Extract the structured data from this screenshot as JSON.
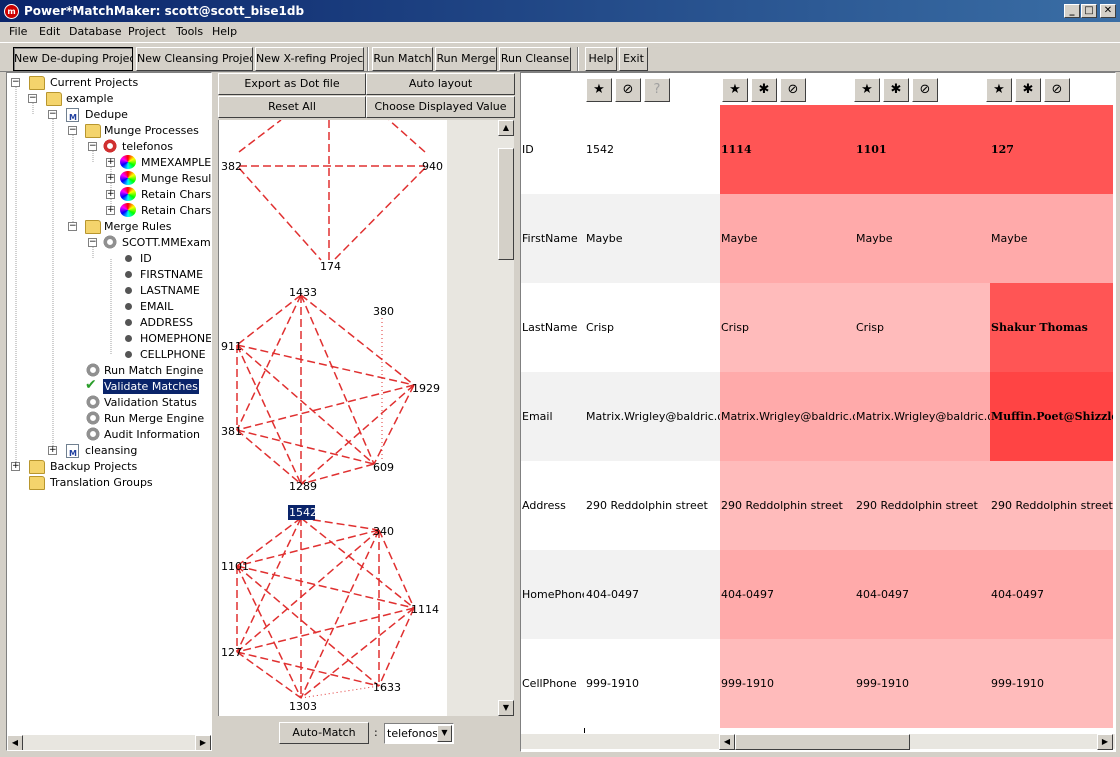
{
  "window": {
    "title": "Power*MatchMaker: scott@scott_bise1db",
    "min": "_",
    "max": "□",
    "close": "✕",
    "app_icon": "pm-logo-icon"
  },
  "menu": [
    "File",
    "Edit",
    "Database",
    "Project",
    "Tools",
    "Help"
  ],
  "toolbar": {
    "new_dedupe": "New De-duping Project",
    "new_cleansing": "New Cleansing Project",
    "new_xref": "New X-refing Project",
    "run_match": "Run Match",
    "run_merge": "Run Merge",
    "run_cleanse": "Run Cleanse",
    "help": "Help",
    "exit": "Exit"
  },
  "tree": {
    "current_projects": "Current Projects",
    "example": "example",
    "dedupe": "Dedupe",
    "munge_processes": "Munge Processes",
    "telefonos": "telefonos",
    "mmexample": "MMEXAMPLETA",
    "munge_results": "Munge Results",
    "retain_chars_1": "Retain Chars",
    "retain_chars_2": "Retain Chars",
    "merge_rules": "Merge Rules",
    "scott_mmexample": "SCOTT.MMExample",
    "columns": [
      "ID",
      "FIRSTNAME",
      "LASTNAME",
      "EMAIL",
      "ADDRESS",
      "HOMEPHONE",
      "CELLPHONE"
    ],
    "run_match_engine": "Run Match Engine",
    "validate_matches": "Validate Matches",
    "validation_status": "Validation Status",
    "run_merge_engine": "Run Merge Engine",
    "audit_information": "Audit Information",
    "cleansing": "cleansing",
    "backup_projects": "Backup Projects",
    "translation_groups": "Translation Groups"
  },
  "graph_panel": {
    "export_dot": "Export as Dot file",
    "auto_layout": "Auto layout",
    "reset_all": "Reset All",
    "choose_displayed": "Choose Displayed Value",
    "auto_match": "Auto-Match",
    "colon": ":",
    "munge_select": "telefonos",
    "selected_node": "1542"
  },
  "graph_nodes": {
    "g1": [
      "382",
      "940",
      "174"
    ],
    "g2": [
      "1433",
      "380",
      "911",
      "1929",
      "381",
      "609",
      "1289"
    ],
    "g3": [
      "1542",
      "340",
      "1101",
      "1114",
      "127",
      "1633",
      "1303"
    ]
  },
  "colors": {
    "strong": "#ff5555",
    "medium": "#ffbbbb",
    "highlight": "#ff4444",
    "edge": "#e03030"
  },
  "grid": {
    "header_icons": [
      "master-record-icon",
      "unmatch-icon",
      "unknown-icon"
    ],
    "rows": [
      {
        "label": "ID",
        "values": [
          "1542",
          "1114",
          "1101",
          "127"
        ]
      },
      {
        "label": "FirstName",
        "values": [
          "Maybe",
          "Maybe",
          "Maybe",
          "Maybe"
        ]
      },
      {
        "label": "LastName",
        "values": [
          "Crisp",
          "Crisp",
          "Crisp",
          "Shakur Thomas"
        ]
      },
      {
        "label": "Email",
        "values": [
          "Matrix.Wrigley@baldric.org",
          "Matrix.Wrigley@baldric.org",
          "Matrix.Wrigley@baldric.org",
          "Muffin.Poet@Shizzle.com"
        ]
      },
      {
        "label": "Address",
        "values": [
          "290 Reddolphin street",
          "290 Reddolphin street",
          "290 Reddolphin street",
          "290 Reddolphin street"
        ]
      },
      {
        "label": "HomePhone",
        "values": [
          "404-0497",
          "404-0497",
          "404-0497",
          "404-0497"
        ]
      },
      {
        "label": "CellPhone",
        "values": [
          "999-1910",
          "999-1910",
          "999-1910",
          "999-1910"
        ]
      }
    ]
  }
}
